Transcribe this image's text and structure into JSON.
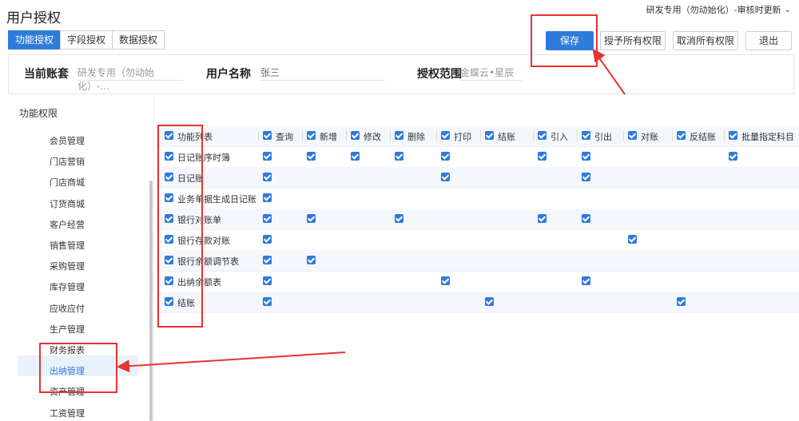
{
  "app": {
    "title": "用户授权",
    "account_selector": "研发专用（勿动始化）-审核时更新"
  },
  "tabs": [
    {
      "label": "功能授权",
      "active": true
    },
    {
      "label": "字段授权",
      "active": false
    },
    {
      "label": "数据授权",
      "active": false
    }
  ],
  "toolbar": {
    "save": "保存",
    "grant_all": "授予所有权限",
    "revoke_all": "取消所有权限",
    "exit": "退出"
  },
  "info": {
    "account_label": "当前账套",
    "account_value": "研发专用（勿动始化）-...",
    "user_label": "用户名称",
    "user_value": "张三",
    "scope_label": "授权范围",
    "scope_value": "金蝶云•星辰"
  },
  "sidebar": {
    "title": "功能权限",
    "items": [
      "会员管理",
      "门店营销",
      "门店商城",
      "订货商城",
      "客户经营",
      "销售管理",
      "采购管理",
      "库存管理",
      "应收应付",
      "生产管理",
      "财务报表",
      "出纳管理",
      "资产管理",
      "工资管理"
    ],
    "selected": "出纳管理"
  },
  "table": {
    "columns": [
      "功能列表",
      "查询",
      "新增",
      "修改",
      "删除",
      "打印",
      "结账",
      "引入",
      "引出",
      "对账",
      "反结账",
      "批量指定科目"
    ],
    "rows": [
      {
        "name": "日记账序时簿",
        "checks": [
          1,
          1,
          1,
          1,
          1,
          0,
          1,
          1,
          0,
          0,
          1
        ]
      },
      {
        "name": "日记账",
        "checks": [
          1,
          0,
          0,
          0,
          1,
          0,
          0,
          1,
          0,
          0,
          0
        ]
      },
      {
        "name": "业务单据生成日记账",
        "checks": [
          1,
          0,
          0,
          0,
          0,
          0,
          0,
          0,
          0,
          0,
          0
        ]
      },
      {
        "name": "银行对账单",
        "checks": [
          1,
          1,
          0,
          1,
          0,
          0,
          1,
          1,
          0,
          0,
          0
        ]
      },
      {
        "name": "银行存款对账",
        "checks": [
          1,
          0,
          0,
          0,
          0,
          0,
          0,
          0,
          1,
          0,
          0
        ]
      },
      {
        "name": "银行余额调节表",
        "checks": [
          1,
          1,
          0,
          0,
          0,
          0,
          0,
          0,
          0,
          0,
          0
        ]
      },
      {
        "name": "出纳余额表",
        "checks": [
          1,
          0,
          0,
          0,
          1,
          0,
          0,
          1,
          0,
          0,
          0
        ]
      },
      {
        "name": "结账",
        "checks": [
          1,
          0,
          0,
          0,
          0,
          1,
          0,
          0,
          0,
          1,
          0
        ]
      }
    ]
  },
  "colors": {
    "accent": "#2f7bdc",
    "annotation": "#e8332f"
  }
}
